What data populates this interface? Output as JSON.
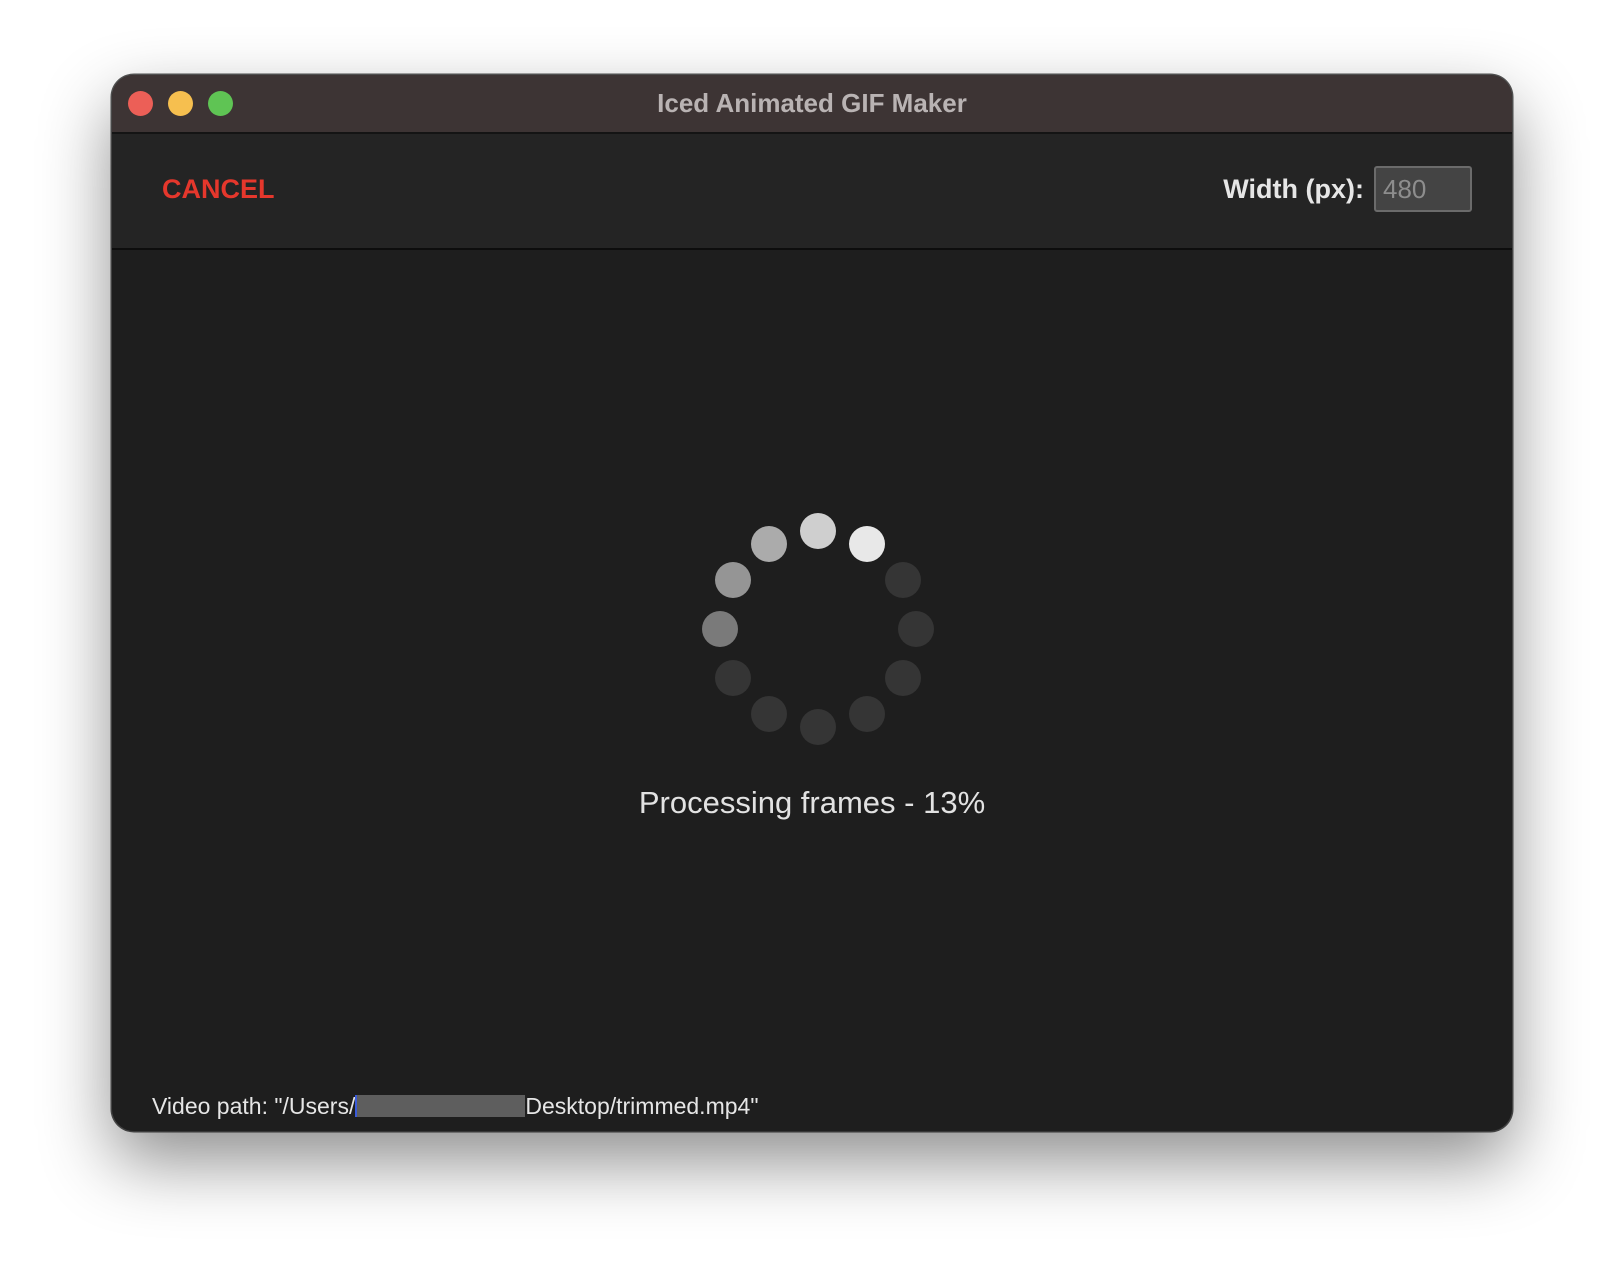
{
  "window": {
    "title": "Iced Animated GIF Maker"
  },
  "toolbar": {
    "cancel_label": "CANCEL",
    "width_label": "Width (px):",
    "width_placeholder": "480"
  },
  "main": {
    "status": "Processing frames - 13%",
    "spinner_icon": "loading-spinner-icon"
  },
  "footer": {
    "path_prefix": "Video path: \"/Users/",
    "path_suffix": "Desktop/trimmed.mp4\""
  },
  "colors": {
    "accent_cancel": "#e5372c",
    "close": "#ec5f57",
    "minimize": "#f6bf4f",
    "maximize": "#5fc454"
  }
}
